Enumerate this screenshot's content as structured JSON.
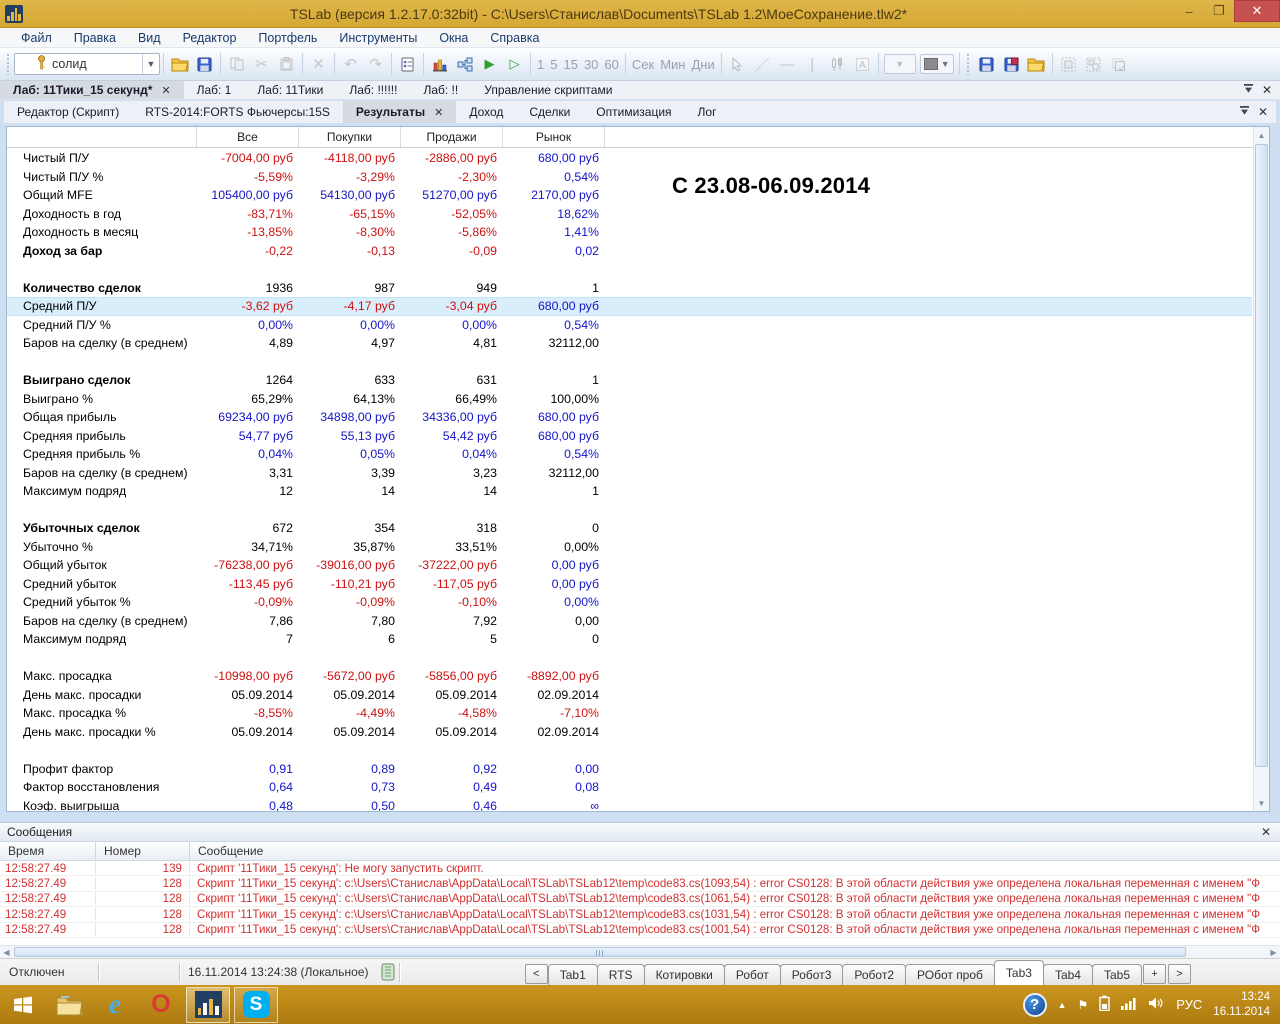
{
  "window": {
    "title": "TSLab (версия 1.2.17.0:32bit) - C:\\Users\\Станислав\\Documents\\TSLab 1.2\\МоеСохранение.tlw2*"
  },
  "menu": {
    "items": [
      "Файл",
      "Правка",
      "Вид",
      "Редактор",
      "Портфель",
      "Инструменты",
      "Окна",
      "Справка"
    ]
  },
  "toolbar": {
    "instrument": "солид",
    "timeframe_numbers": [
      "1",
      "5",
      "15",
      "30",
      "60"
    ],
    "timeframe_units": [
      "Сек",
      "Мин",
      "Дни"
    ],
    "icons": [
      "key-icon",
      "open-icon",
      "save-icon",
      "copy-icon",
      "cut-icon",
      "paste-icon",
      "delete-icon",
      "undo-icon",
      "redo-icon",
      "properties-icon",
      "chart-icon",
      "script-schema-icon",
      "run-icon",
      "run-step-icon",
      "cursor-icon",
      "line-icon",
      "hline-icon",
      "vline-icon",
      "candles-icon",
      "text-icon",
      "color-swatch-icon"
    ]
  },
  "lab_tabs": [
    {
      "label": "Лаб: 11Тики_15 секунд*",
      "active": true,
      "closable": true
    },
    {
      "label": "Лаб: 1"
    },
    {
      "label": "Лаб: 11Тики"
    },
    {
      "label": "Лаб: !!!!!!"
    },
    {
      "label": "Лаб: !!"
    },
    {
      "label": "Управление скриптами"
    }
  ],
  "result_tabs": [
    {
      "label": "Редактор (Скрипт)"
    },
    {
      "label": "RTS-2014:FORTS Фьючерсы:15S"
    },
    {
      "label": "Результаты",
      "active": true,
      "closable": true
    },
    {
      "label": "Доход"
    },
    {
      "label": "Сделки"
    },
    {
      "label": "Оптимизация"
    },
    {
      "label": "Лог"
    }
  ],
  "results": {
    "columns": [
      "Все",
      "Покупки",
      "Продажи",
      "Рынок"
    ],
    "annotation": "С 23.08-06.09.2014",
    "rows": [
      {
        "l": "Чистый П/У",
        "v": [
          "-7004,00 руб",
          "-4118,00 руб",
          "-2886,00 руб",
          "680,00 руб"
        ],
        "c": [
          "r",
          "r",
          "r",
          "b"
        ]
      },
      {
        "l": "Чистый П/У %",
        "v": [
          "-5,59%",
          "-3,29%",
          "-2,30%",
          "0,54%"
        ],
        "c": [
          "r",
          "r",
          "r",
          "b"
        ]
      },
      {
        "l": "Общий MFE",
        "v": [
          "105400,00 руб",
          "54130,00 руб",
          "51270,00 руб",
          "2170,00 руб"
        ],
        "c": [
          "b",
          "b",
          "b",
          "b"
        ]
      },
      {
        "l": "Доходность в год",
        "v": [
          "-83,71%",
          "-65,15%",
          "-52,05%",
          "18,62%"
        ],
        "c": [
          "r",
          "r",
          "r",
          "b"
        ]
      },
      {
        "l": "Доходность в месяц",
        "v": [
          "-13,85%",
          "-8,30%",
          "-5,86%",
          "1,41%"
        ],
        "c": [
          "r",
          "r",
          "r",
          "b"
        ]
      },
      {
        "l": "Доход за бар",
        "v": [
          "-0,22",
          "-0,13",
          "-0,09",
          "0,02"
        ],
        "c": [
          "r",
          "r",
          "r",
          "b"
        ],
        "bold": true
      },
      {
        "sp": true
      },
      {
        "l": "Количество сделок",
        "v": [
          "1936",
          "987",
          "949",
          "1"
        ],
        "c": [
          "k",
          "k",
          "k",
          "k"
        ],
        "bold": true
      },
      {
        "l": "Средний П/У",
        "v": [
          "-3,62 руб",
          "-4,17 руб",
          "-3,04 руб",
          "680,00 руб"
        ],
        "c": [
          "r",
          "r",
          "r",
          "b"
        ],
        "hl": true
      },
      {
        "l": "Средний П/У %",
        "v": [
          "0,00%",
          "0,00%",
          "0,00%",
          "0,54%"
        ],
        "c": [
          "b",
          "b",
          "b",
          "b"
        ]
      },
      {
        "l": "Баров на сделку (в среднем)",
        "v": [
          "4,89",
          "4,97",
          "4,81",
          "32112,00"
        ],
        "c": [
          "k",
          "k",
          "k",
          "k"
        ]
      },
      {
        "sp": true
      },
      {
        "l": "Выиграно сделок",
        "v": [
          "1264",
          "633",
          "631",
          "1"
        ],
        "c": [
          "k",
          "k",
          "k",
          "k"
        ],
        "bold": true
      },
      {
        "l": "Выиграно %",
        "v": [
          "65,29%",
          "64,13%",
          "66,49%",
          "100,00%"
        ],
        "c": [
          "k",
          "k",
          "k",
          "k"
        ]
      },
      {
        "l": "Общая прибыль",
        "v": [
          "69234,00 руб",
          "34898,00 руб",
          "34336,00 руб",
          "680,00 руб"
        ],
        "c": [
          "b",
          "b",
          "b",
          "b"
        ]
      },
      {
        "l": "Средняя прибыль",
        "v": [
          "54,77 руб",
          "55,13 руб",
          "54,42 руб",
          "680,00 руб"
        ],
        "c": [
          "b",
          "b",
          "b",
          "b"
        ]
      },
      {
        "l": "Средняя прибыль %",
        "v": [
          "0,04%",
          "0,05%",
          "0,04%",
          "0,54%"
        ],
        "c": [
          "b",
          "b",
          "b",
          "b"
        ]
      },
      {
        "l": "Баров на сделку (в среднем)",
        "v": [
          "3,31",
          "3,39",
          "3,23",
          "32112,00"
        ],
        "c": [
          "k",
          "k",
          "k",
          "k"
        ]
      },
      {
        "l": "Максимум подряд",
        "v": [
          "12",
          "14",
          "14",
          "1"
        ],
        "c": [
          "k",
          "k",
          "k",
          "k"
        ]
      },
      {
        "sp": true
      },
      {
        "l": "Убыточных сделок",
        "v": [
          "672",
          "354",
          "318",
          "0"
        ],
        "c": [
          "k",
          "k",
          "k",
          "k"
        ],
        "bold": true
      },
      {
        "l": "Убыточно %",
        "v": [
          "34,71%",
          "35,87%",
          "33,51%",
          "0,00%"
        ],
        "c": [
          "k",
          "k",
          "k",
          "k"
        ]
      },
      {
        "l": "Общий убыток",
        "v": [
          "-76238,00 руб",
          "-39016,00 руб",
          "-37222,00 руб",
          "0,00 руб"
        ],
        "c": [
          "r",
          "r",
          "r",
          "b"
        ]
      },
      {
        "l": "Средний убыток",
        "v": [
          "-113,45 руб",
          "-110,21 руб",
          "-117,05 руб",
          "0,00 руб"
        ],
        "c": [
          "r",
          "r",
          "r",
          "b"
        ]
      },
      {
        "l": "Средний убыток %",
        "v": [
          "-0,09%",
          "-0,09%",
          "-0,10%",
          "0,00%"
        ],
        "c": [
          "r",
          "r",
          "r",
          "b"
        ]
      },
      {
        "l": "Баров на сделку (в среднем)",
        "v": [
          "7,86",
          "7,80",
          "7,92",
          "0,00"
        ],
        "c": [
          "k",
          "k",
          "k",
          "k"
        ]
      },
      {
        "l": "Максимум подряд",
        "v": [
          "7",
          "6",
          "5",
          "0"
        ],
        "c": [
          "k",
          "k",
          "k",
          "k"
        ]
      },
      {
        "sp": true
      },
      {
        "l": "Макс. просадка",
        "v": [
          "-10998,00 руб",
          "-5672,00 руб",
          "-5856,00 руб",
          "-8892,00 руб"
        ],
        "c": [
          "r",
          "r",
          "r",
          "r"
        ]
      },
      {
        "l": "День макс. просадки",
        "v": [
          "05.09.2014",
          "05.09.2014",
          "05.09.2014",
          "02.09.2014"
        ],
        "c": [
          "k",
          "k",
          "k",
          "k"
        ]
      },
      {
        "l": "Макс. просадка %",
        "v": [
          "-8,55%",
          "-4,49%",
          "-4,58%",
          "-7,10%"
        ],
        "c": [
          "r",
          "r",
          "r",
          "r"
        ]
      },
      {
        "l": "День макс. просадки %",
        "v": [
          "05.09.2014",
          "05.09.2014",
          "05.09.2014",
          "02.09.2014"
        ],
        "c": [
          "k",
          "k",
          "k",
          "k"
        ]
      },
      {
        "sp": true
      },
      {
        "l": "Профит фактор",
        "v": [
          "0,91",
          "0,89",
          "0,92",
          "0,00"
        ],
        "c": [
          "b",
          "b",
          "b",
          "b"
        ]
      },
      {
        "l": "Фактор восстановления",
        "v": [
          "0,64",
          "0,73",
          "0,49",
          "0,08"
        ],
        "c": [
          "b",
          "b",
          "b",
          "b"
        ]
      },
      {
        "l": "Коэф. выигрыша",
        "v": [
          "0,48",
          "0,50",
          "0,46",
          "∞"
        ],
        "c": [
          "b",
          "b",
          "b",
          "b"
        ]
      }
    ]
  },
  "messages": {
    "title": "Сообщения",
    "columns": [
      "Время",
      "Номер",
      "Сообщение"
    ],
    "rows": [
      {
        "time": "12:58:27.49",
        "number": "139",
        "text": "Скрипт '11Тики_15 секунд': Не могу запустить скрипт."
      },
      {
        "time": "12:58:27.49",
        "number": "128",
        "text": "Скрипт '11Тики_15 секунд': c:\\Users\\Станислав\\AppData\\Local\\TSLab\\TSLab12\\temp\\code83.cs(1093,54) : error CS0128: В этой области действия уже определена локальная переменная с именем \"Ф"
      },
      {
        "time": "12:58:27.49",
        "number": "128",
        "text": "Скрипт '11Тики_15 секунд': c:\\Users\\Станислав\\AppData\\Local\\TSLab\\TSLab12\\temp\\code83.cs(1061,54) : error CS0128: В этой области действия уже определена локальная переменная с именем \"Ф"
      },
      {
        "time": "12:58:27.49",
        "number": "128",
        "text": "Скрипт '11Тики_15 секунд': c:\\Users\\Станислав\\AppData\\Local\\TSLab\\TSLab12\\temp\\code83.cs(1031,54) : error CS0128: В этой области действия уже определена локальная переменная с именем \"Ф"
      },
      {
        "time": "12:58:27.49",
        "number": "128",
        "text": "Скрипт '11Тики_15 секунд': c:\\Users\\Станислав\\AppData\\Local\\TSLab\\TSLab12\\temp\\code83.cs(1001,54) : error CS0128: В этой области действия уже определена локальная переменная с именем \"Ф"
      }
    ]
  },
  "status": {
    "connection": "Отключен",
    "clock": "16.11.2014 13:24:38 (Локальное)",
    "nav_left": "<",
    "nav_right": ">",
    "add_tab": "+",
    "tabs": [
      {
        "label": "Tab1"
      },
      {
        "label": "RTS"
      },
      {
        "label": "Котировки"
      },
      {
        "label": "Робот"
      },
      {
        "label": "Робот3"
      },
      {
        "label": "Робот2"
      },
      {
        "label": "РОбот проб"
      },
      {
        "label": "Tab3",
        "active": true
      },
      {
        "label": "Tab4"
      },
      {
        "label": "Tab5"
      }
    ]
  },
  "taskbar": {
    "apps": [
      "start-icon",
      "explorer-icon",
      "internet-explorer-icon",
      "opera-icon",
      "tslab-icon",
      "skype-icon"
    ],
    "tray": {
      "language": "РУС",
      "time": "13:24",
      "date": "16.11.2014"
    }
  },
  "colors": {
    "accent_gold": "#d5a833",
    "negative": "#cc1111",
    "positive": "#1414c8",
    "error": "#d23131"
  }
}
